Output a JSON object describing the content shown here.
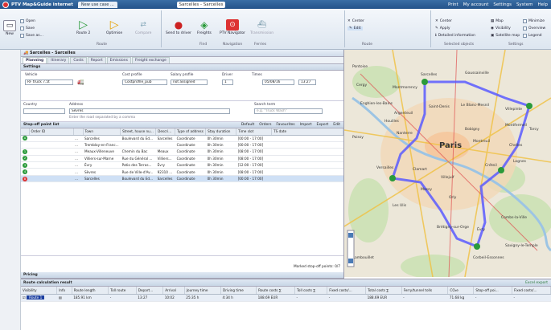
{
  "window": {
    "app_title": "PTV Map&Guide internet",
    "tab_label": "New use case ...",
    "center_title": "Sarcelles - Sarcelles",
    "links": [
      "Print",
      "My account",
      "Settings",
      "System",
      "Help"
    ]
  },
  "ribbon": {
    "open": "Open",
    "save": "Save",
    "save_as": "Save as...",
    "new": "New",
    "route2": "Route 2",
    "optimise": "Optimise",
    "compare": "Compare",
    "send_to_driver": "Send to driver",
    "freights": "Freights",
    "ptv_navigator": "PTV Navigator",
    "transmission": "Transmission",
    "group_route": "Route",
    "group_find": "Find",
    "group_navigation": "Navigation",
    "group_ferries": "Ferries",
    "center": "Center",
    "edit": "Edit",
    "sel_center": "Center",
    "apply": "Apply",
    "detailed_info": "Detailed information",
    "map": "Map",
    "visibility": "Visibility",
    "satellite_map": "Satellite map",
    "minimize": "Minimize",
    "overview": "Overview",
    "legend": "Legend",
    "group_route2": "Route",
    "group_selected_objects": "Selected objects",
    "group_settings": "Settings"
  },
  "left_panel": {
    "header": "Sarcelles - Sarcelles",
    "tabs": [
      "Planning",
      "Itinerary",
      "Costs",
      "Report",
      "Emissions",
      "Freight exchange"
    ],
    "settings_label": "Settings",
    "vehicle_label": "Vehicle",
    "vehicle_value": "RF truck 7.5t",
    "cost_profile_label": "Cost profile",
    "cost_profile_value": "Costprofile_pub",
    "salary_profile_label": "Salary profile",
    "salary_profile_value": "not assigned",
    "driver_label": "Driver",
    "driver_value": "1",
    "times_label": "Times",
    "date_value": "05/08/16",
    "time_value": "13:27",
    "country_label": "Country",
    "address_label": "Address",
    "address_value": "Sèvres",
    "address_hint": "Enter the road separated by a comma",
    "search_term_label": "Search term",
    "search_term_placeholder": "e.g. \"Truck Wash\"",
    "stopoff_label": "Stop-off point list",
    "stopoff_tools": [
      "Default",
      "Orders",
      "Favourites",
      "Import",
      "Export",
      "Edit"
    ],
    "columns": [
      "Order ID",
      "Town",
      "Street, house nu...",
      "Descri...",
      "Type of address",
      "Stay duration",
      "Time slot",
      "TS date"
    ],
    "rows": [
      {
        "marker": "A",
        "color": "#2a9a3a",
        "town": "Sarcelles",
        "street": "Boulevard du Ed...",
        "desc": "Sarcelles",
        "type": "Coordinate",
        "stay": "0h 30min",
        "slot": "[00:00 - 17:00]"
      },
      {
        "marker": "",
        "color": "",
        "town": "Tremblay-en-Franc...",
        "street": "",
        "desc": "",
        "type": "Coordinate",
        "stay": "0h 30min",
        "slot": "[00:00 - 17:00]"
      },
      {
        "marker": "1",
        "color": "#2a9a3a",
        "town": "Meaux-Villeneuve",
        "street": "Chemin du Bac",
        "desc": "Meaux",
        "type": "Coordinate",
        "stay": "0h 30min",
        "slot": "[08:00 - 17:00]"
      },
      {
        "marker": "2",
        "color": "#2a9a3a",
        "town": "Villiers-sur-Marne",
        "street": "Rue du Général ...",
        "desc": "Villiers...",
        "type": "Coordinate",
        "stay": "0h 30min",
        "slot": "[08:00 - 17:00]"
      },
      {
        "marker": "3",
        "color": "#2a9a3a",
        "town": "Évry",
        "street": "Patio des Terras...",
        "desc": "Évry",
        "type": "Coordinate",
        "stay": "0h 30min",
        "slot": "[12:00 - 17:00]"
      },
      {
        "marker": "4",
        "color": "#2a9a3a",
        "town": "Sèvres",
        "street": "Rue de Ville-d'Av...",
        "desc": "92310 ...",
        "type": "Coordinate",
        "stay": "0h 30min",
        "slot": "[08:00 - 17:00]"
      },
      {
        "marker": "B",
        "color": "#d33",
        "town": "Sarcelles",
        "street": "Boulevard du Ed...",
        "desc": "Sarcelles",
        "type": "Coordinate",
        "stay": "0h 30min",
        "slot": "[00:00 - 17:00]"
      }
    ],
    "marked_points": "Marked stop-off points: 0/7",
    "pricing_label": "Pricing"
  },
  "results": {
    "header": "Route calculation result",
    "excel_export": "Excel export",
    "columns": [
      "Visibility",
      "Info",
      "Route length",
      "Toll route",
      "Depart...",
      "Arrival",
      "Journey time",
      "Driving time",
      "Route costs ∑",
      "Toll costs ∑",
      "Fixed costs/...",
      "Total costs ∑",
      "Ferry/tunnel tolls",
      "CO₂e",
      "Stop-off poi...",
      "Fixed costs/..."
    ],
    "row": {
      "name": "Route 1",
      "length": "185.91 km",
      "toll": "-",
      "depart": "13:27",
      "arrival": "10:02",
      "journey": "25:35 h",
      "driving": "4:34 h",
      "route_costs": "188.69 EUR",
      "toll_costs": "-",
      "fixed": "-",
      "total": "188.69 EUR",
      "ferry": "-",
      "co2": "71.68 kg",
      "stop": "-",
      "fixed2": "-"
    }
  },
  "map": {
    "labels": [
      "Pontoise",
      "Sarcelles",
      "Montmorency",
      "Goussainville",
      "Enghien-les-Bains",
      "Argenteuil",
      "Saint-Denis",
      "Le Blanc-Mesnil",
      "Villepinte",
      "Bobigny",
      "Montfermeil",
      "Chelles",
      "Nanterre",
      "Paris",
      "Montreuil",
      "Versailles",
      "Clamart",
      "Créteil",
      "Villejuif",
      "Massy",
      "Orly",
      "Les Ulis",
      "Évry",
      "Corbeil-Essonnes",
      "Brétigny-sur-Orge",
      "Savigny-le-Temple",
      "Combs-la-Ville",
      "Houilles",
      "Rambouillet",
      "Lognes",
      "Torcy",
      "Poissy",
      "Cergy"
    ]
  }
}
